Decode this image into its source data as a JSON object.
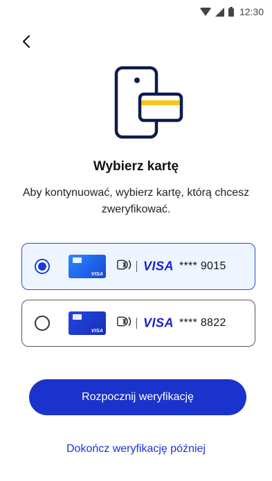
{
  "status_bar": {
    "time": "12:30",
    "icons": [
      "wifi-icon",
      "signal-icon",
      "battery-icon"
    ]
  },
  "header": {
    "back_icon": "chevron-left-icon"
  },
  "hero": {
    "icon": "phone-with-card-icon",
    "colors": {
      "outline": "#0d1b4c",
      "stripe": "#f5c518"
    }
  },
  "title": "Wybierz kartę",
  "subtitle": "Aby kontynuować, wybierz kartę, którą chcesz zweryfikować.",
  "cards": [
    {
      "selected": true,
      "thumb_brand": "VISA",
      "contactless_icon": "contactless-icon",
      "network": "VISA",
      "number": "**** 9015"
    },
    {
      "selected": false,
      "thumb_brand": "VISA",
      "contactless_icon": "contactless-icon",
      "network": "VISA",
      "number": "**** 8822"
    }
  ],
  "actions": {
    "primary_label": "Rozpocznij weryfikację",
    "secondary_label": "Dokończ weryfikację później"
  },
  "colors": {
    "accent": "#1a33cc",
    "selected_bg": "#eef5ff",
    "visa_blue": "#1a1fd0"
  }
}
